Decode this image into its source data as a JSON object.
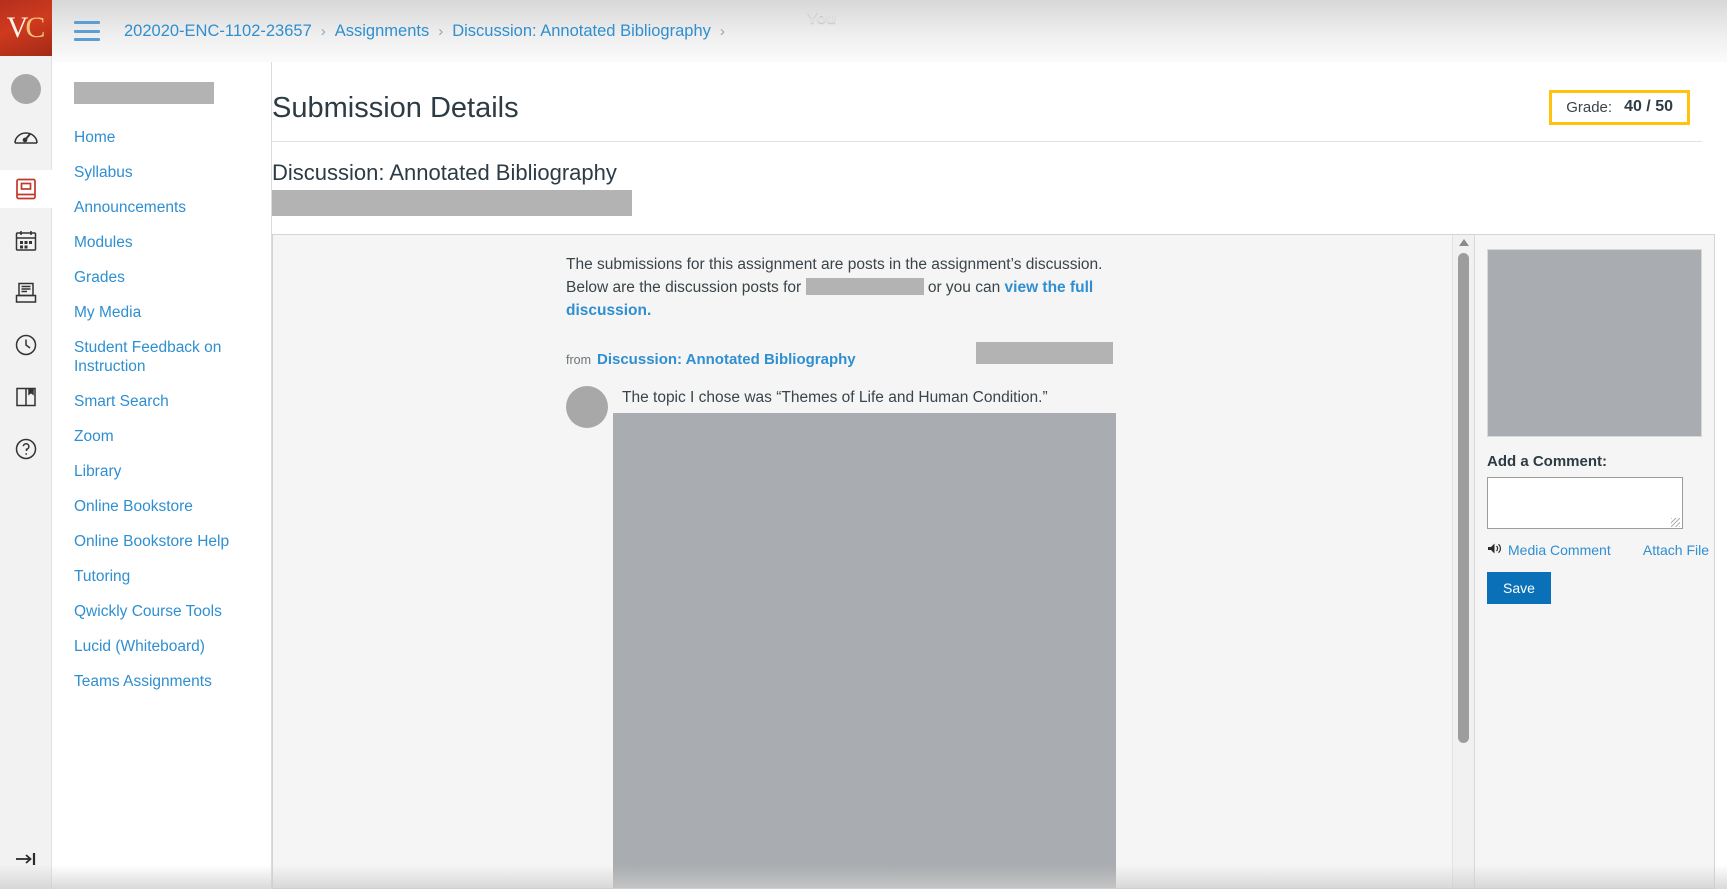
{
  "brand": {
    "logo_text": "VC",
    "logo_v": "V",
    "logo_c": "C",
    "accent": "#b4301d",
    "link_color": "#2f8fd0"
  },
  "rail": {
    "items": [
      {
        "name": "account-avatar",
        "label": "Account"
      },
      {
        "name": "dashboard-icon",
        "label": "Dashboard"
      },
      {
        "name": "courses-icon",
        "label": "Courses"
      },
      {
        "name": "calendar-icon",
        "label": "Calendar"
      },
      {
        "name": "inbox-icon",
        "label": "Inbox"
      },
      {
        "name": "history-icon",
        "label": "History"
      },
      {
        "name": "bookmarks-icon",
        "label": "Bookmarks"
      },
      {
        "name": "help-icon",
        "label": "Help"
      }
    ],
    "collapse_label": "Expand navigation"
  },
  "topbar": {
    "menu_label": "Menu",
    "watermark": "You",
    "breadcrumbs": [
      {
        "label": "202020-ENC-1102-23657"
      },
      {
        "label": "Assignments"
      },
      {
        "label": "Discussion: Annotated Bibliography"
      }
    ],
    "separator": "›"
  },
  "coursenav": {
    "items": [
      {
        "label": "Home"
      },
      {
        "label": "Syllabus"
      },
      {
        "label": "Announcements"
      },
      {
        "label": "Modules"
      },
      {
        "label": "Grades"
      },
      {
        "label": "My Media"
      },
      {
        "label": "Student Feedback on Instruction"
      },
      {
        "label": "Smart Search"
      },
      {
        "label": "Zoom"
      },
      {
        "label": "Library"
      },
      {
        "label": "Online Bookstore"
      },
      {
        "label": "Online Bookstore Help"
      },
      {
        "label": "Tutoring"
      },
      {
        "label": "Qwickly Course Tools"
      },
      {
        "label": "Lucid (Whiteboard)"
      },
      {
        "label": "Teams Assignments"
      }
    ]
  },
  "main": {
    "page_title": "Submission Details",
    "grade": {
      "label": "Grade:",
      "value": "40 / 50",
      "highlight_color": "#ffc20e"
    },
    "assignment_title": "Discussion: Annotated Bibliography",
    "submission": {
      "intro_part1": "The submissions for this assignment are posts in the assignment’s discussion. Below are the discussion posts for ",
      "intro_part2": " or you can ",
      "intro_link": "view the full discussion.",
      "from_keyword": "from",
      "from_link": "Discussion: Annotated Bibliography",
      "post_text": "The topic I chose was “Themes of Life and Human Condition.” Using the poets Langston Hughes and Nancy Byrd Turner."
    }
  },
  "comments": {
    "add_label": "Add a Comment:",
    "textarea_value": "",
    "textarea_placeholder": "",
    "media_comment": "Media Comment",
    "attach_file": "Attach File",
    "save_label": "Save",
    "save_color": "#0a70b8"
  }
}
